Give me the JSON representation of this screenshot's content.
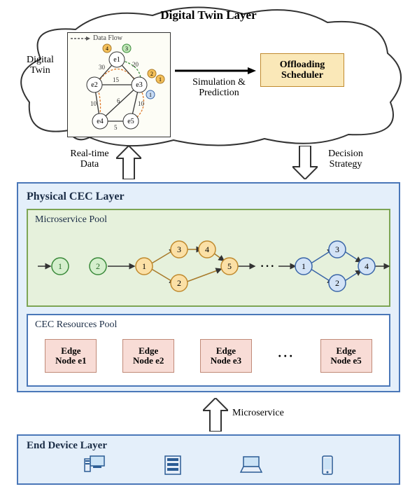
{
  "digital_twin": {
    "title": "Digital Twin Layer",
    "panel_label": "Digital\nTwin",
    "data_flow_label": "Data Flow",
    "sim_pred_label": "Simulation &\nPrediction",
    "scheduler_label": "Offloading\nScheduler",
    "graph": {
      "nodes": [
        "e1",
        "e2",
        "e3",
        "e4",
        "e5"
      ],
      "edge_weights": {
        "e1-e2": 30,
        "e1-e3": 20,
        "e2-e3": 15,
        "e2-e4": 10,
        "e3-e4": 6,
        "e3-e5": 10,
        "e4-e5": 5
      },
      "microservice_badges": [
        {
          "near": "e1",
          "id": 3,
          "color": "green"
        },
        {
          "near": "e1",
          "id": 4,
          "color": "orange"
        },
        {
          "near": "e3",
          "id": 2,
          "color": "orange"
        },
        {
          "near": "e3",
          "id": 1,
          "color": "orange"
        },
        {
          "near": "e3",
          "id": 1,
          "color": "blue"
        }
      ]
    }
  },
  "arrows": {
    "real_time_data": "Real-time\nData",
    "decision_strategy": "Decision\nStrategy",
    "microservice": "Microservice"
  },
  "physical_layer": {
    "title": "Physical CEC Layer",
    "microservice_pool": {
      "title": "Microservice Pool",
      "groups": [
        {
          "color": "green",
          "nodes": [
            1,
            2
          ]
        },
        {
          "color": "orange",
          "nodes": [
            1,
            2,
            3,
            4,
            5
          ],
          "edges": [
            [
              1,
              3
            ],
            [
              1,
              2
            ],
            [
              3,
              4
            ],
            [
              2,
              5
            ],
            [
              4,
              5
            ]
          ]
        },
        {
          "color": "blue",
          "nodes": [
            1,
            2,
            3,
            4
          ],
          "edges": [
            [
              1,
              3
            ],
            [
              1,
              2
            ],
            [
              3,
              4
            ],
            [
              2,
              4
            ]
          ]
        }
      ],
      "ellipsis": "···"
    },
    "cec_resources_pool": {
      "title": "CEC Resources Pool",
      "nodes": [
        "Edge\nNode e1",
        "Edge\nNode e2",
        "Edge\nNode e3",
        "Edge\nNode e5"
      ],
      "ellipsis": "···"
    }
  },
  "end_layer": {
    "title": "End Device Layer",
    "devices": [
      "desktop",
      "server",
      "laptop",
      "phone"
    ]
  }
}
